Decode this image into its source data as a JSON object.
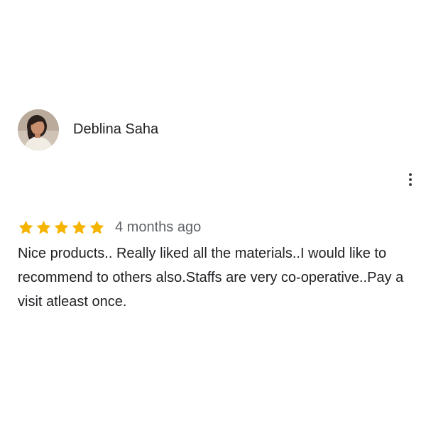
{
  "review": {
    "reviewer": {
      "name": "Deblina Saha",
      "avatar_icon": "user-photo-avatar"
    },
    "more_options_icon": "more-vert-icon",
    "rating": {
      "stars": 5,
      "max_stars": 5,
      "star_color": "#F5B400",
      "star_icon": "star-icon"
    },
    "date": "4 months ago",
    "text": "Nice products.. Really liked all the materials..I would like to recommend to others also.Staffs are very co-operative..Pay a visit atleast once."
  }
}
